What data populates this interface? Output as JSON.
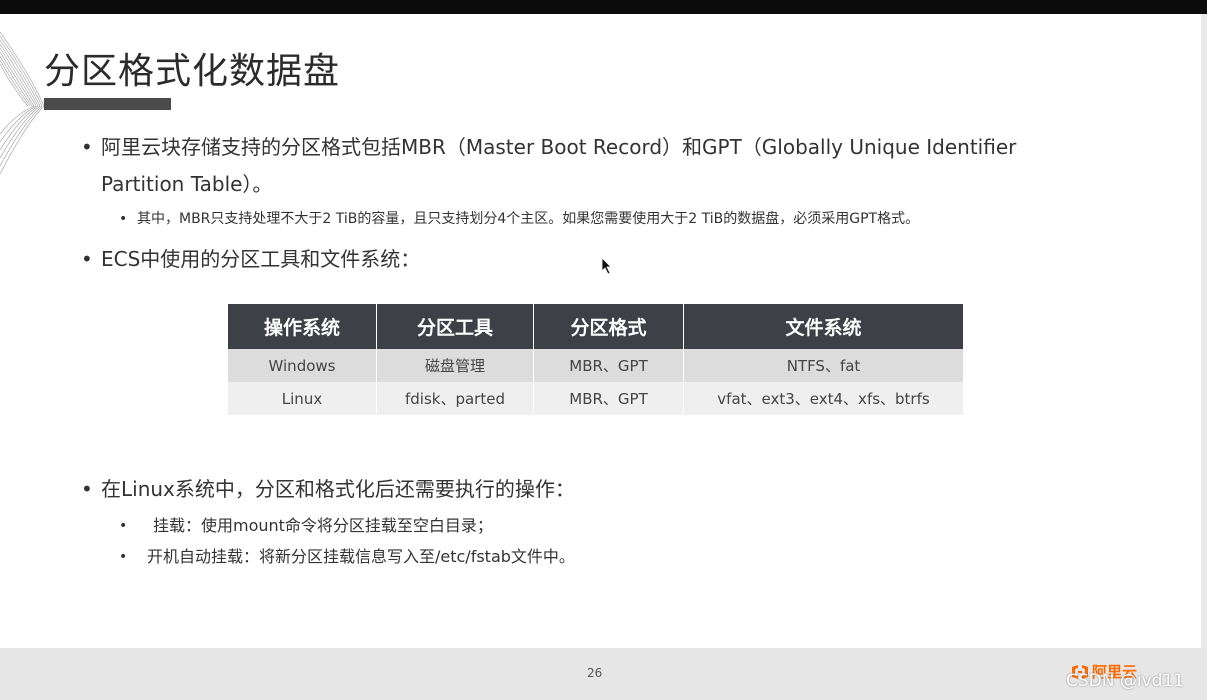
{
  "slide": {
    "title": "分区格式化数据盘",
    "bullet1_line1": "阿里云块存储支持的分区格式包括MBR（Master Boot Record）和GPT（Globally Unique Identifier",
    "bullet1_line2": "Partition Table）。",
    "sub1": "其中，MBR只支持处理不大于2 TiB的容量，且只支持划分4个主区。如果您需要使用大于2 TiB的数据盘，必须采用GPT格式。",
    "bullet2": "ECS中使用的分区工具和文件系统：",
    "table": {
      "headers": [
        "操作系统",
        "分区工具",
        "分区格式",
        "文件系统"
      ],
      "rows": [
        [
          "Windows",
          "磁盘管理",
          "MBR、GPT",
          "NTFS、fat"
        ],
        [
          "Linux",
          "fdisk、parted",
          "MBR、GPT",
          "vfat、ext3、ext4、xfs、btrfs"
        ]
      ]
    },
    "bullet3": "在Linux系统中，分区和格式化后还需要执行的操作：",
    "sub3a": "挂载：使用mount命令将分区挂载至空白目录；",
    "sub3b": "开机自动挂载：将新分区挂载信息写入至/etc/fstab文件中。",
    "bullet_glyph": "•",
    "sub_glyph": "•"
  },
  "footer": {
    "page_number": "26",
    "logo_text": "阿里云",
    "watermark": "CSDN @ivd11"
  },
  "colors": {
    "brand_orange": "#ff6a00",
    "table_header": "#3d4147",
    "accent_bar": "#4b4b4b"
  },
  "icons": [
    "cursor-arrow-icon",
    "aliyun-logo-icon",
    "slide-corner-decoration"
  ]
}
